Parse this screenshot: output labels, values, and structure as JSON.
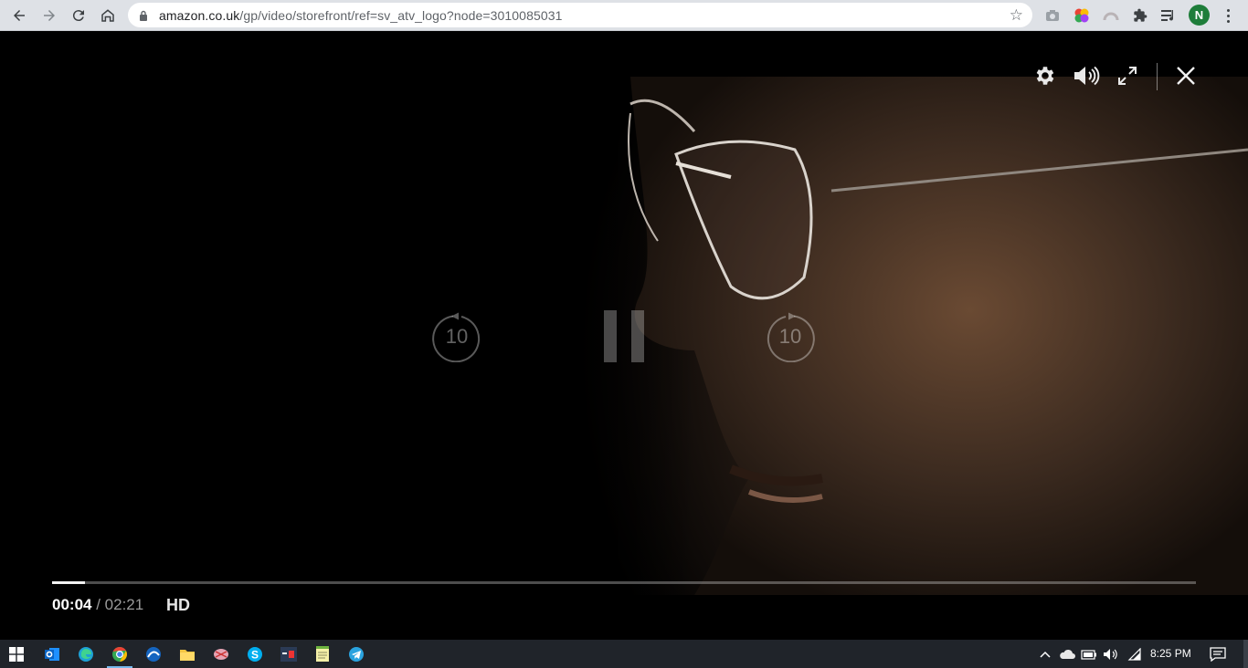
{
  "browser": {
    "url_host": "amazon.co.uk",
    "url_path": "/gp/video/storefront/ref=sv_atv_logo?node=3010085031",
    "profile_initial": "N"
  },
  "player": {
    "skip_back_label": "10",
    "skip_forward_label": "10",
    "current_time": "00:04",
    "time_separator": " / ",
    "duration": "02:21",
    "quality_badge": "HD",
    "progress_fraction": 0.0284
  },
  "taskbar": {
    "clock": "8:25 PM"
  },
  "colors": {
    "browser_chrome": "#dee1e6",
    "taskbar": "#20242a",
    "profile_avatar": "#1e7d3a"
  }
}
